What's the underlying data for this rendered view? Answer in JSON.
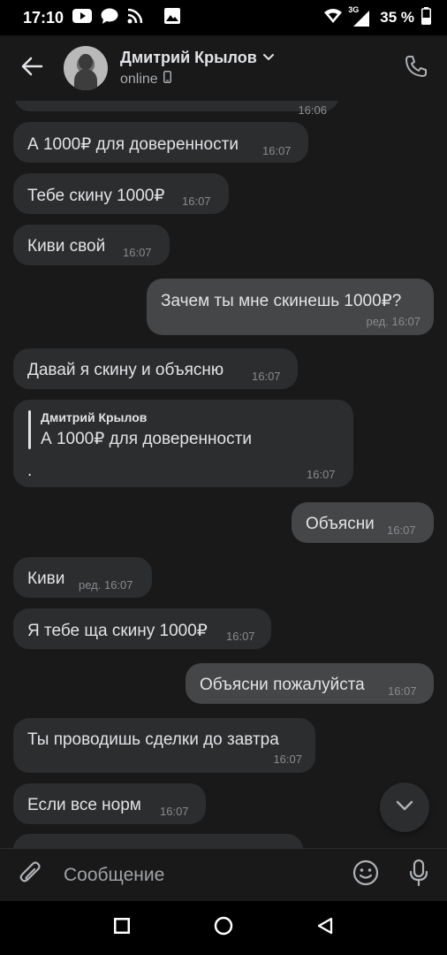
{
  "status_bar": {
    "time": "17:10",
    "network": "3G",
    "battery": "35 %",
    "left_icons": [
      "youtube-icon",
      "chat-bubble-icon",
      "rss-icon",
      "image-icon"
    ],
    "right_icons": [
      "wifi-icon",
      "signal-icon",
      "battery-icon"
    ]
  },
  "header": {
    "title": "Дмитрий Крылов",
    "status": "online",
    "icons": [
      "back-arrow-icon",
      "avatar",
      "chevron-down-icon",
      "mobile-device-icon",
      "phone-icon"
    ]
  },
  "messages": [
    {
      "dir": "in",
      "text": "А 1000₽ для доверенности",
      "time": "16:07"
    },
    {
      "dir": "in",
      "text": "Тебе скину 1000₽",
      "time": "16:07"
    },
    {
      "dir": "in",
      "text": "Киви свой",
      "time": "16:07"
    },
    {
      "dir": "out",
      "text": "Зачем ты мне скинешь 1000₽?",
      "time": "ред. 16:07"
    },
    {
      "dir": "in",
      "text": "Давай я скину и объясню",
      "time": "16:07"
    },
    {
      "dir": "in",
      "reply_author": "Дмитрий Крылов",
      "reply_text": "А 1000₽ для доверенности",
      "text": ".",
      "time": "16:07"
    },
    {
      "dir": "out",
      "text": "Объясни",
      "time": "16:07"
    },
    {
      "dir": "in",
      "text": "Киви",
      "time": "ред. 16:07"
    },
    {
      "dir": "in",
      "text": "Я тебе ща скину 1000₽",
      "time": "16:07"
    },
    {
      "dir": "out",
      "text": "Объясни пожалуйста",
      "time": "16:07"
    },
    {
      "dir": "in",
      "text": "Ты проводишь сделки до завтра",
      "time": "16:07"
    },
    {
      "dir": "in",
      "text": "Если все норм",
      "time": "16:07"
    }
  ],
  "partial_top_time": "16:06",
  "composer": {
    "placeholder": "Сообщение",
    "icons": [
      "paperclip-icon",
      "emoji-icon",
      "microphone-icon"
    ]
  },
  "scroll_down_icon": "chevron-down-icon",
  "nav_bar": {
    "icons": [
      "recents-square-icon",
      "home-circle-icon",
      "back-triangle-icon"
    ]
  },
  "colors": {
    "background": "#19191a",
    "incoming_bubble": "#2c2d2e",
    "outgoing_bubble": "#454647",
    "text": "#e1e3e6",
    "time": "#888b8f"
  }
}
